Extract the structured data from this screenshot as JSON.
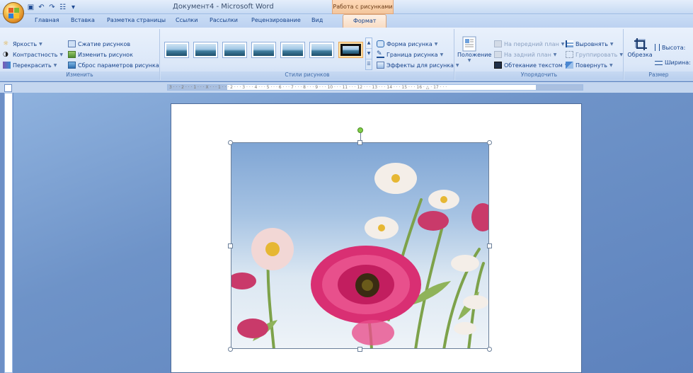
{
  "window": {
    "title": "Документ4 - Microsoft Word",
    "context_tab_group": "Работа с рисунками"
  },
  "tabs": [
    {
      "label": "Главная"
    },
    {
      "label": "Вставка"
    },
    {
      "label": "Разметка страницы"
    },
    {
      "label": "Ссылки"
    },
    {
      "label": "Рассылки"
    },
    {
      "label": "Рецензирование"
    },
    {
      "label": "Вид"
    },
    {
      "label": "Формат",
      "active": true
    }
  ],
  "ribbon": {
    "adjust": {
      "label": "Изменить",
      "brightness": "Яркость",
      "contrast": "Контрастность",
      "recolor": "Перекрасить",
      "compress": "Сжатие рисунков",
      "change_picture": "Изменить рисунок",
      "reset_picture": "Сброс параметров рисунка"
    },
    "styles": {
      "label": "Стили рисунков",
      "thumbnail_count": 7,
      "shape": "Форма рисунка",
      "border": "Граница рисунка",
      "effects": "Эффекты для рисунка"
    },
    "arrange": {
      "label": "Упорядочить",
      "position": "Положение",
      "bring_front": "На передний план",
      "send_back": "На задний план",
      "wrap_text": "Обтекание текстом",
      "align": "Выровнять",
      "group": "Группировать",
      "rotate": "Повернуть"
    },
    "size": {
      "label": "Размер",
      "crop": "Обрезка",
      "height": "Высота:",
      "width": "Ширина:"
    }
  },
  "ruler": {
    "text": "3 · · · 2 · · · 1 · · · X · · · 1 · · · 2 · · · 3 · · · 4 · · · 5 · · · 6 · · · 7 · · · 8 · · · 9 · · · 10 · · · 11 · · · 12 · · · 13 · · · 14 · · · 15 · · · 16 · △ · 17 · · ·"
  },
  "colors": {
    "ribbon_bg": "#dbe7f8",
    "context_tab": "#f8dcc4",
    "workspace_bg": "#6d8fc6",
    "flower_pink": "#d92f73",
    "flower_white": "#f6efe9"
  }
}
